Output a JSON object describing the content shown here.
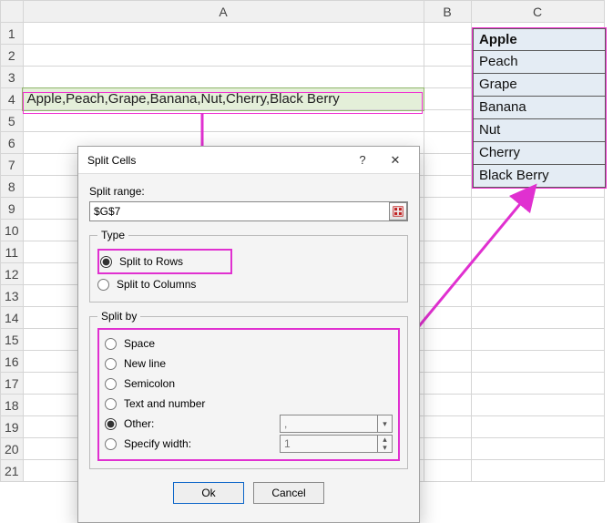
{
  "columns": {
    "a": "A",
    "b": "B",
    "c": "C"
  },
  "rows": [
    "1",
    "2",
    "3",
    "4",
    "5",
    "6",
    "7",
    "8",
    "9",
    "10",
    "11",
    "12",
    "13",
    "14",
    "15",
    "16",
    "17",
    "18",
    "19",
    "20",
    "21"
  ],
  "cell_a4": "Apple,Peach,Grape,Banana,Nut,Cherry,Black Berry",
  "result": [
    "Apple",
    "Peach",
    "Grape",
    "Banana",
    "Nut",
    "Cherry",
    "Black Berry"
  ],
  "dialog": {
    "title": "Split Cells",
    "help": "?",
    "close": "✕",
    "split_range_label": "Split range:",
    "range_value": "$G$7",
    "type_legend": "Type",
    "type_rows": "Split to Rows",
    "type_cols": "Split to Columns",
    "splitby_legend": "Split by",
    "by_space": "Space",
    "by_newline": "New line",
    "by_semicolon": "Semicolon",
    "by_textnum": "Text and number",
    "by_other": "Other:",
    "by_width": "Specify width:",
    "other_value": ",",
    "width_value": "1",
    "ok": "Ok",
    "cancel": "Cancel"
  }
}
